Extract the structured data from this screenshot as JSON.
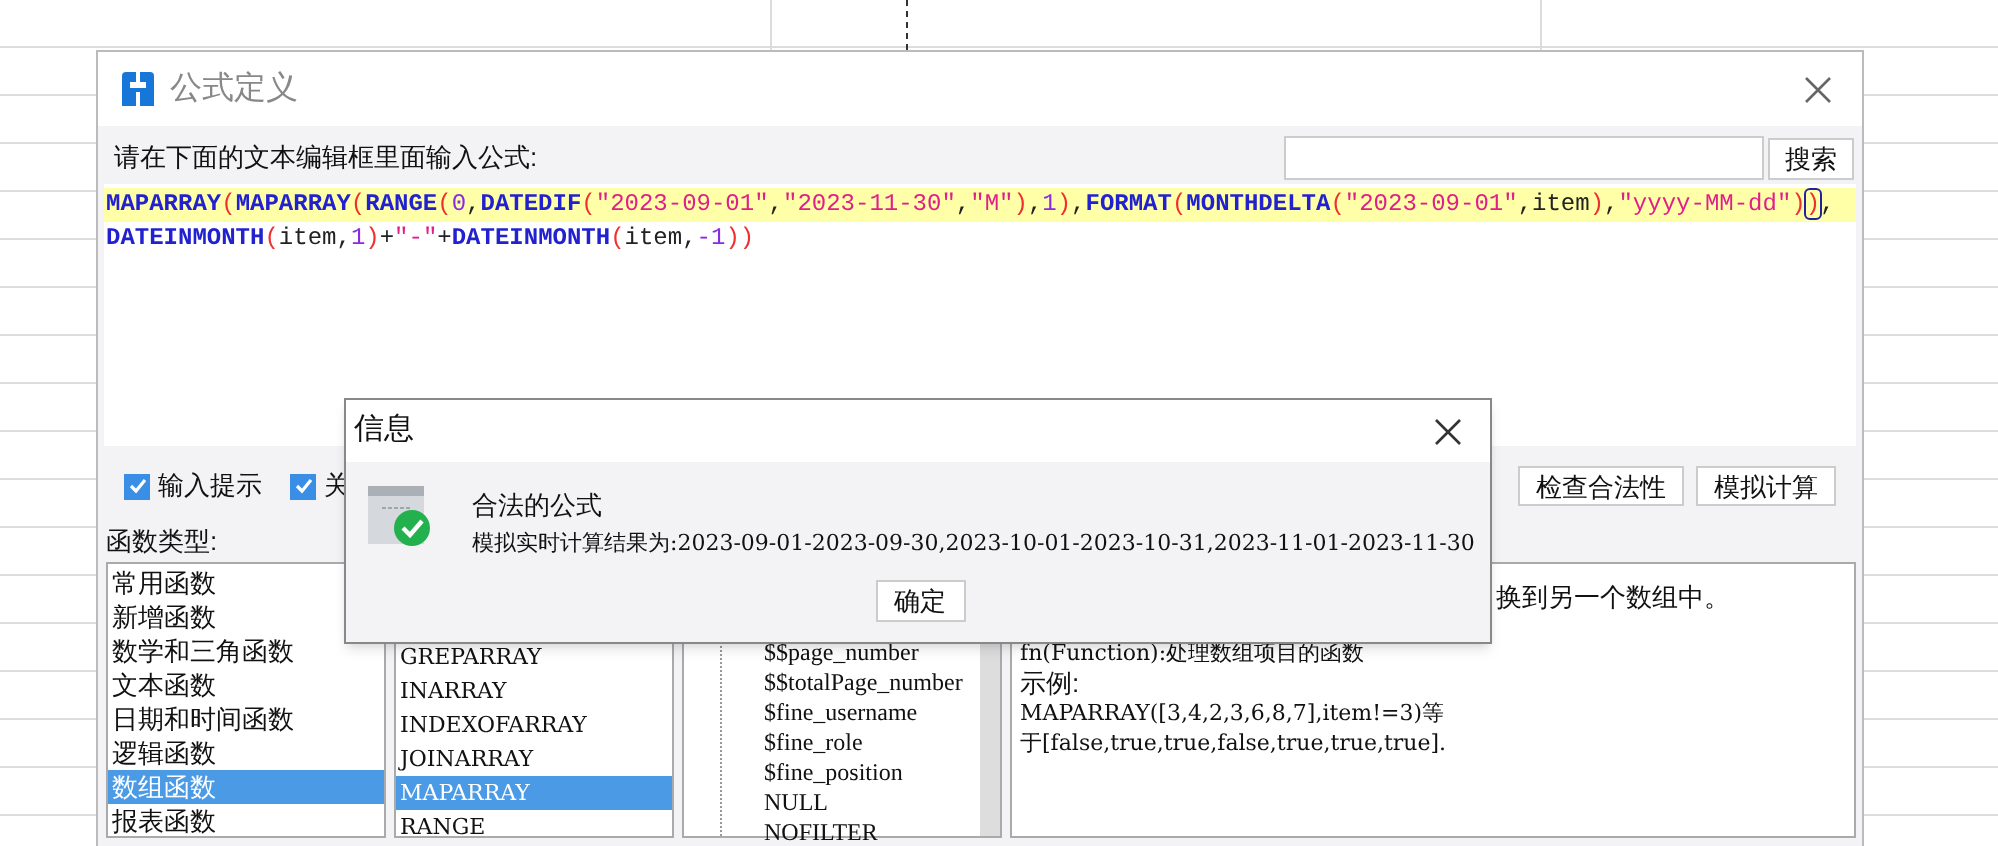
{
  "window": {
    "title": "公式定义"
  },
  "prompt": "请在下面的文本编辑框里面输入公式:",
  "search": {
    "button": "搜索"
  },
  "formula_lines": [
    {
      "current": true,
      "tokens": [
        {
          "kind": "fn",
          "text": "MAPARRAY"
        },
        {
          "kind": "paren",
          "text": "("
        },
        {
          "kind": "fn",
          "text": "MAPARRAY"
        },
        {
          "kind": "paren",
          "text": "("
        },
        {
          "kind": "fn",
          "text": "RANGE"
        },
        {
          "kind": "paren",
          "text": "("
        },
        {
          "kind": "num",
          "text": "0"
        },
        {
          "kind": "punct",
          "text": ","
        },
        {
          "kind": "fn",
          "text": "DATEDIF"
        },
        {
          "kind": "paren",
          "text": "("
        },
        {
          "kind": "str",
          "text": "\"2023-09-01\""
        },
        {
          "kind": "punct",
          "text": ","
        },
        {
          "kind": "str",
          "text": "\"2023-11-30\""
        },
        {
          "kind": "punct",
          "text": ","
        },
        {
          "kind": "str",
          "text": "\"M\""
        },
        {
          "kind": "paren",
          "text": ")"
        },
        {
          "kind": "punct",
          "text": ","
        },
        {
          "kind": "num",
          "text": "1"
        },
        {
          "kind": "paren",
          "text": ")"
        },
        {
          "kind": "punct",
          "text": ","
        },
        {
          "kind": "fn",
          "text": "FORMAT"
        },
        {
          "kind": "paren",
          "text": "("
        },
        {
          "kind": "fn",
          "text": "MONTHDELTA"
        },
        {
          "kind": "paren",
          "text": "("
        },
        {
          "kind": "str",
          "text": "\"2023-09-01\""
        },
        {
          "kind": "punct",
          "text": ","
        },
        {
          "kind": "var",
          "text": "item"
        },
        {
          "kind": "paren",
          "text": ")"
        },
        {
          "kind": "punct",
          "text": ","
        },
        {
          "kind": "str",
          "text": "\"yyyy-MM-dd\""
        },
        {
          "kind": "paren",
          "text": ")"
        },
        {
          "kind": "paren_match",
          "text": ")"
        },
        {
          "kind": "punct",
          "text": ","
        }
      ]
    },
    {
      "current": false,
      "tokens": [
        {
          "kind": "fn",
          "text": "DATEINMONTH"
        },
        {
          "kind": "paren",
          "text": "("
        },
        {
          "kind": "var",
          "text": "item"
        },
        {
          "kind": "punct",
          "text": ","
        },
        {
          "kind": "num",
          "text": "1"
        },
        {
          "kind": "paren",
          "text": ")"
        },
        {
          "kind": "punct",
          "text": "+"
        },
        {
          "kind": "str",
          "text": "\"-\""
        },
        {
          "kind": "punct",
          "text": "+"
        },
        {
          "kind": "fn",
          "text": "DATEINMONTH"
        },
        {
          "kind": "paren",
          "text": "("
        },
        {
          "kind": "var",
          "text": "item"
        },
        {
          "kind": "punct",
          "text": ","
        },
        {
          "kind": "num",
          "text": "-1"
        },
        {
          "kind": "paren",
          "text": ")"
        },
        {
          "kind": "paren",
          "text": ")"
        }
      ]
    }
  ],
  "options": [
    {
      "label": "输入提示",
      "checked": true
    },
    {
      "label": "关",
      "checked": true
    }
  ],
  "actions": [
    "检查合法性",
    "模拟计算"
  ],
  "function_types": {
    "label": "函数类型:",
    "items": [
      {
        "label": "常用函数",
        "selected": false
      },
      {
        "label": "新增函数",
        "selected": false
      },
      {
        "label": "数学和三角函数",
        "selected": false
      },
      {
        "label": "文本函数",
        "selected": false
      },
      {
        "label": "日期和时间函数",
        "selected": false
      },
      {
        "label": "逻辑函数",
        "selected": false
      },
      {
        "label": "数组函数",
        "selected": true
      },
      {
        "label": "报表函数",
        "selected": false
      }
    ]
  },
  "functions": [
    {
      "label": "GREPARRAY",
      "selected": false
    },
    {
      "label": "INARRAY",
      "selected": false
    },
    {
      "label": "INDEXOFARRAY",
      "selected": false
    },
    {
      "label": "JOINARRAY",
      "selected": false
    },
    {
      "label": "MAPARRAY",
      "selected": true
    },
    {
      "label": "RANGE",
      "selected": false
    }
  ],
  "parameters": [
    "$$page_number",
    "$$totalPage_number",
    "$fine_username",
    "$fine_role",
    "$fine_position",
    "NULL",
    "NOFILTER"
  ],
  "description": [
    "换到另一个数组中。",
    "fn(Function):处理数组项目的函数",
    "示例:",
    "MAPARRAY([3,4,2,3,6,8,7],item!=3)等",
    "于[false,true,true,false,true,true,true]."
  ],
  "message_dialog": {
    "title": "信息",
    "heading": "合法的公式",
    "result": "模拟实时计算结果为:2023-09-01-2023-09-30,2023-10-01-2023-10-31,2023-11-01-2023-11-30",
    "button": "确定"
  }
}
